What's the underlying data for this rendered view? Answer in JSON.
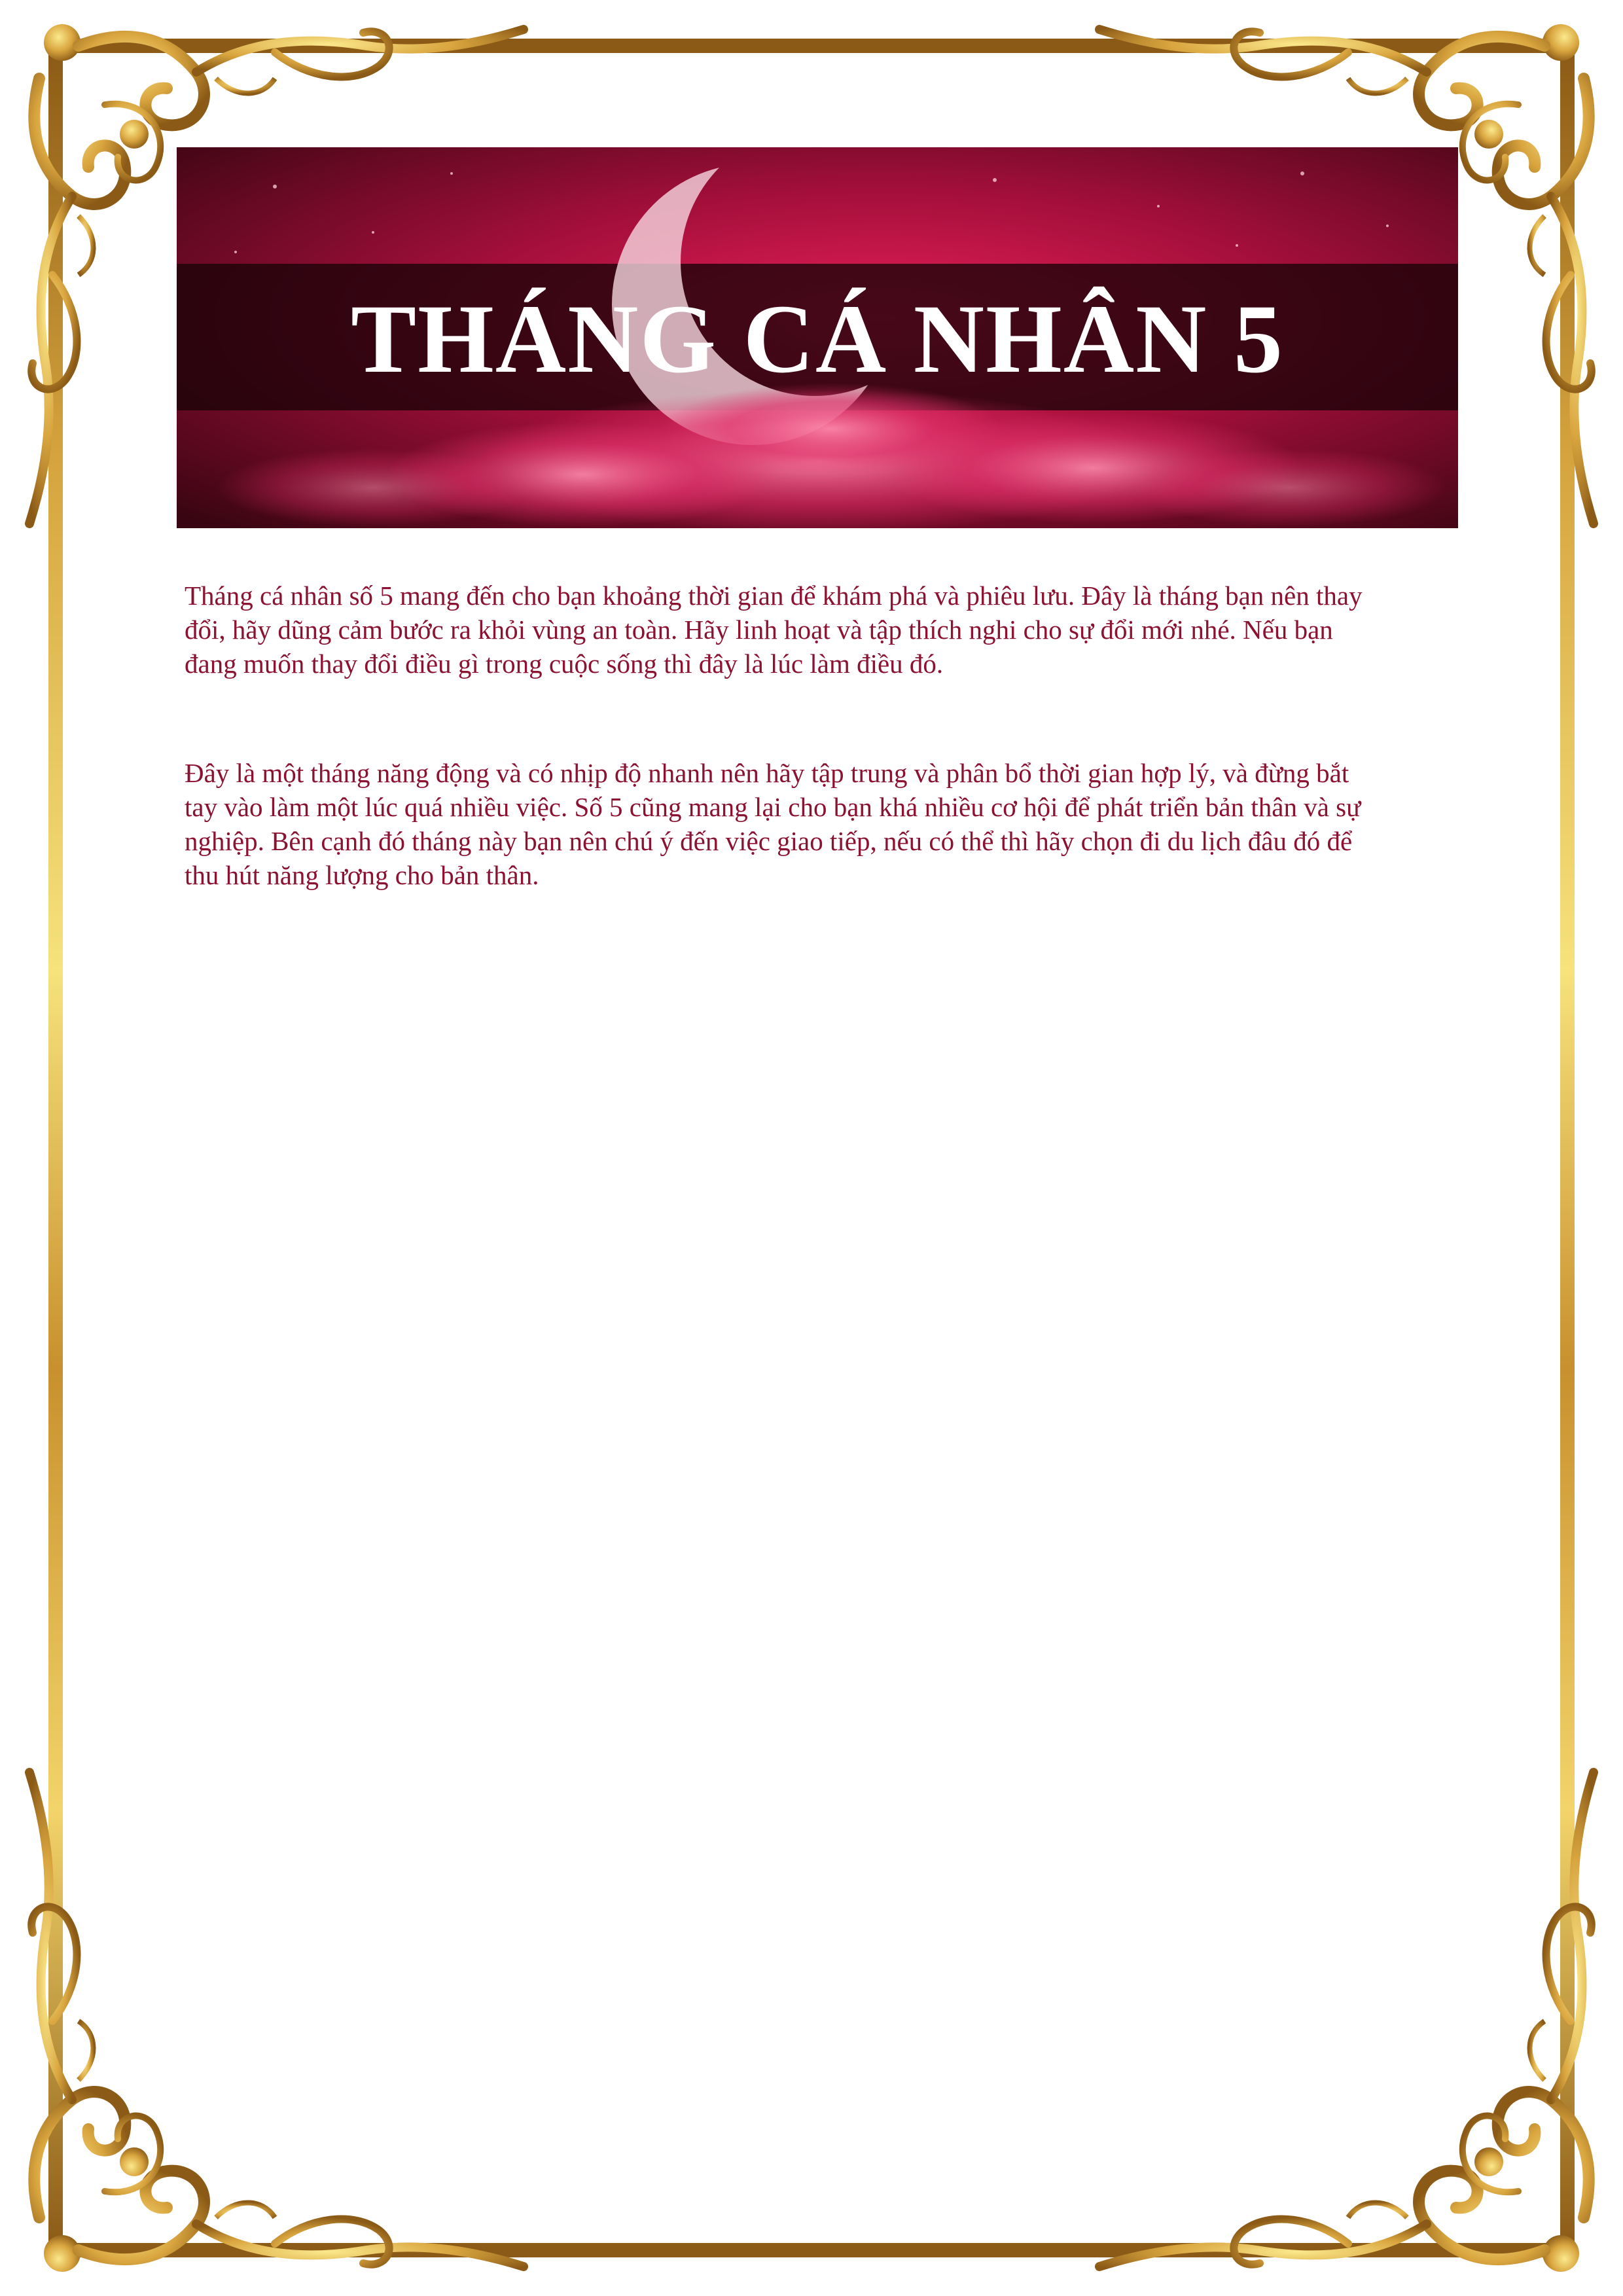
{
  "banner": {
    "title": "THÁNG CÁ NHÂN 5"
  },
  "content": {
    "paragraphs": [
      "Tháng cá nhân số 5 mang đến cho bạn khoảng thời gian để khám phá và phiêu lưu. Đây là tháng bạn nên thay đổi, hãy dũng cảm bước ra khỏi vùng an toàn. Hãy linh hoạt và tập thích nghi cho sự đổi mới nhé. Nếu bạn đang muốn thay đổi điều gì trong cuộc sống thì đây là lúc làm điều đó.",
      "Đây là một tháng năng động và có nhịp độ nhanh nên hãy tập trung và phân bổ thời gian hợp lý, và đừng bắt tay vào làm một lúc quá nhiều việc. Số 5 cũng mang lại cho bạn khá nhiều cơ hội để phát triển bản thân và sự nghiệp. Bên cạnh đó tháng này bạn nên chú ý đến việc giao tiếp, nếu có thể thì hãy chọn đi du lịch đâu đó để thu hút năng lượng cho bản thân."
    ]
  },
  "colors": {
    "gold_dark": "#8a5a16",
    "gold_light": "#f7e27c",
    "banner_crimson": "#d11a4e",
    "banner_dark": "#3a0512",
    "text": "#8b1230"
  },
  "icons": [
    "ornate-gold-frame",
    "crescent-moon",
    "pink-clouds",
    "stars"
  ]
}
